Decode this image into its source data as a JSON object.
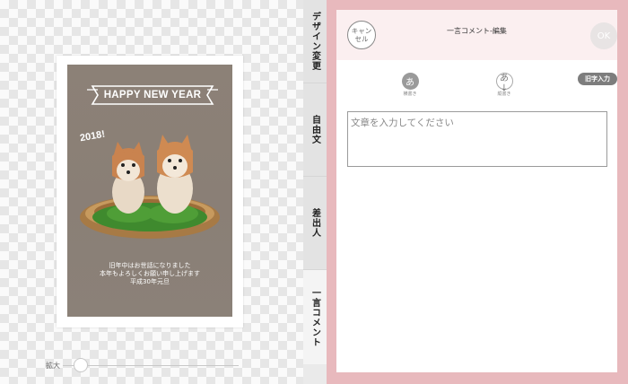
{
  "preview": {
    "card": {
      "banner_text": "HAPPY NEW YEAR",
      "year_text": "2018!",
      "greeting_lines": [
        "旧年中はお世話になりました",
        "本年もよろしくお願い申し上げます",
        "平成30年元旦"
      ]
    },
    "zoom": {
      "label": "拡大",
      "level": 0.1
    }
  },
  "tabs": [
    {
      "label": "デザイン変更",
      "active": false
    },
    {
      "label": "自由文",
      "active": false
    },
    {
      "label": "差出人",
      "active": false
    },
    {
      "label": "一言コメント",
      "active": true
    }
  ],
  "editor": {
    "cancel_label": "キャンセル",
    "title": "一言コメント-編集",
    "ok_label": "OK",
    "options": [
      {
        "glyph": "あ",
        "label": "横書き"
      },
      {
        "glyph": "あ↓",
        "label": "縦書き"
      }
    ],
    "kyuji_label": "旧字入力",
    "comment": {
      "value": "",
      "placeholder": "文章を入力してください"
    }
  },
  "colors": {
    "panel_frame": "#e8b9bd",
    "header_bg": "#fbeff0",
    "photo_bg": "#8b8178"
  }
}
